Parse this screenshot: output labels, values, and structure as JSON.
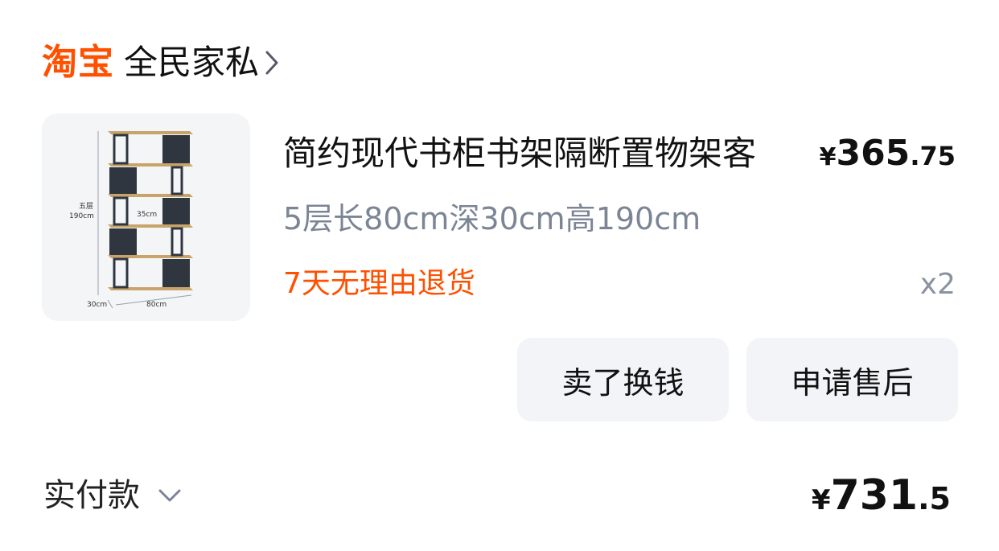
{
  "shop": {
    "platform": "淘宝",
    "name": "全民家私",
    "icon": "chevron-right-icon"
  },
  "item": {
    "image": {
      "icon": "bookshelf-product-image",
      "layers_label": "五层",
      "height_label": "190cm",
      "gap_label": "35cm",
      "depth_label": "30cm",
      "width_label": "80cm"
    },
    "title": "简约现代书柜书架隔断置物架客",
    "price": {
      "currency": "¥",
      "integer": "365",
      "decimal": ".75"
    },
    "spec": "5层长80cm深30cm高190cm",
    "service": "7天无理由退货",
    "quantity": "x2"
  },
  "actions": {
    "sell_label": "卖了换钱",
    "after_sales_label": "申请售后"
  },
  "payment": {
    "label": "实付款",
    "icon": "chevron-down-icon",
    "amount": {
      "currency": "¥",
      "integer": "731",
      "decimal": ".5"
    }
  },
  "colors": {
    "brand": "#ff5000",
    "muted": "#7c8595",
    "button_bg": "#f2f4f7",
    "text": "#111111"
  }
}
